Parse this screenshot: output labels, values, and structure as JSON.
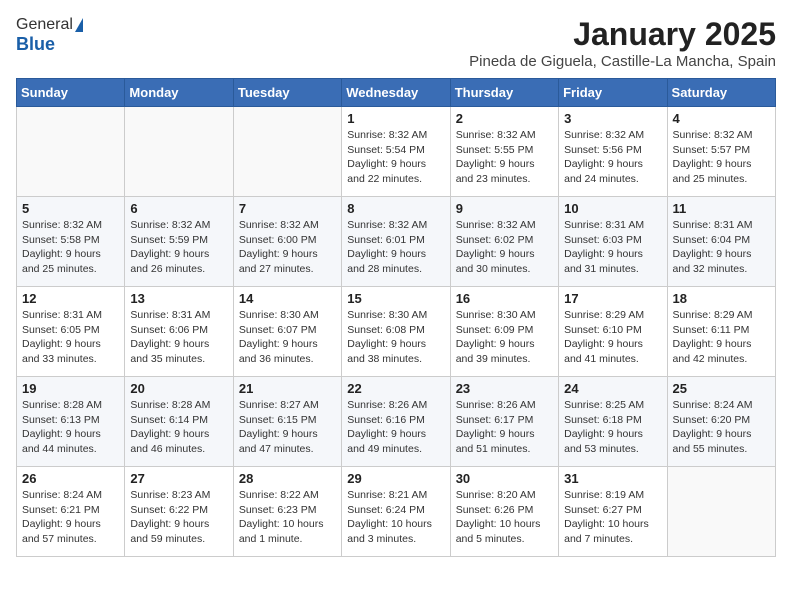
{
  "header": {
    "logo_general": "General",
    "logo_blue": "Blue",
    "month_title": "January 2025",
    "location": "Pineda de Giguela, Castille-La Mancha, Spain"
  },
  "days_of_week": [
    "Sunday",
    "Monday",
    "Tuesday",
    "Wednesday",
    "Thursday",
    "Friday",
    "Saturday"
  ],
  "weeks": [
    [
      {
        "day": "",
        "info": ""
      },
      {
        "day": "",
        "info": ""
      },
      {
        "day": "",
        "info": ""
      },
      {
        "day": "1",
        "info": "Sunrise: 8:32 AM\nSunset: 5:54 PM\nDaylight: 9 hours\nand 22 minutes."
      },
      {
        "day": "2",
        "info": "Sunrise: 8:32 AM\nSunset: 5:55 PM\nDaylight: 9 hours\nand 23 minutes."
      },
      {
        "day": "3",
        "info": "Sunrise: 8:32 AM\nSunset: 5:56 PM\nDaylight: 9 hours\nand 24 minutes."
      },
      {
        "day": "4",
        "info": "Sunrise: 8:32 AM\nSunset: 5:57 PM\nDaylight: 9 hours\nand 25 minutes."
      }
    ],
    [
      {
        "day": "5",
        "info": "Sunrise: 8:32 AM\nSunset: 5:58 PM\nDaylight: 9 hours\nand 25 minutes."
      },
      {
        "day": "6",
        "info": "Sunrise: 8:32 AM\nSunset: 5:59 PM\nDaylight: 9 hours\nand 26 minutes."
      },
      {
        "day": "7",
        "info": "Sunrise: 8:32 AM\nSunset: 6:00 PM\nDaylight: 9 hours\nand 27 minutes."
      },
      {
        "day": "8",
        "info": "Sunrise: 8:32 AM\nSunset: 6:01 PM\nDaylight: 9 hours\nand 28 minutes."
      },
      {
        "day": "9",
        "info": "Sunrise: 8:32 AM\nSunset: 6:02 PM\nDaylight: 9 hours\nand 30 minutes."
      },
      {
        "day": "10",
        "info": "Sunrise: 8:31 AM\nSunset: 6:03 PM\nDaylight: 9 hours\nand 31 minutes."
      },
      {
        "day": "11",
        "info": "Sunrise: 8:31 AM\nSunset: 6:04 PM\nDaylight: 9 hours\nand 32 minutes."
      }
    ],
    [
      {
        "day": "12",
        "info": "Sunrise: 8:31 AM\nSunset: 6:05 PM\nDaylight: 9 hours\nand 33 minutes."
      },
      {
        "day": "13",
        "info": "Sunrise: 8:31 AM\nSunset: 6:06 PM\nDaylight: 9 hours\nand 35 minutes."
      },
      {
        "day": "14",
        "info": "Sunrise: 8:30 AM\nSunset: 6:07 PM\nDaylight: 9 hours\nand 36 minutes."
      },
      {
        "day": "15",
        "info": "Sunrise: 8:30 AM\nSunset: 6:08 PM\nDaylight: 9 hours\nand 38 minutes."
      },
      {
        "day": "16",
        "info": "Sunrise: 8:30 AM\nSunset: 6:09 PM\nDaylight: 9 hours\nand 39 minutes."
      },
      {
        "day": "17",
        "info": "Sunrise: 8:29 AM\nSunset: 6:10 PM\nDaylight: 9 hours\nand 41 minutes."
      },
      {
        "day": "18",
        "info": "Sunrise: 8:29 AM\nSunset: 6:11 PM\nDaylight: 9 hours\nand 42 minutes."
      }
    ],
    [
      {
        "day": "19",
        "info": "Sunrise: 8:28 AM\nSunset: 6:13 PM\nDaylight: 9 hours\nand 44 minutes."
      },
      {
        "day": "20",
        "info": "Sunrise: 8:28 AM\nSunset: 6:14 PM\nDaylight: 9 hours\nand 46 minutes."
      },
      {
        "day": "21",
        "info": "Sunrise: 8:27 AM\nSunset: 6:15 PM\nDaylight: 9 hours\nand 47 minutes."
      },
      {
        "day": "22",
        "info": "Sunrise: 8:26 AM\nSunset: 6:16 PM\nDaylight: 9 hours\nand 49 minutes."
      },
      {
        "day": "23",
        "info": "Sunrise: 8:26 AM\nSunset: 6:17 PM\nDaylight: 9 hours\nand 51 minutes."
      },
      {
        "day": "24",
        "info": "Sunrise: 8:25 AM\nSunset: 6:18 PM\nDaylight: 9 hours\nand 53 minutes."
      },
      {
        "day": "25",
        "info": "Sunrise: 8:24 AM\nSunset: 6:20 PM\nDaylight: 9 hours\nand 55 minutes."
      }
    ],
    [
      {
        "day": "26",
        "info": "Sunrise: 8:24 AM\nSunset: 6:21 PM\nDaylight: 9 hours\nand 57 minutes."
      },
      {
        "day": "27",
        "info": "Sunrise: 8:23 AM\nSunset: 6:22 PM\nDaylight: 9 hours\nand 59 minutes."
      },
      {
        "day": "28",
        "info": "Sunrise: 8:22 AM\nSunset: 6:23 PM\nDaylight: 10 hours\nand 1 minute."
      },
      {
        "day": "29",
        "info": "Sunrise: 8:21 AM\nSunset: 6:24 PM\nDaylight: 10 hours\nand 3 minutes."
      },
      {
        "day": "30",
        "info": "Sunrise: 8:20 AM\nSunset: 6:26 PM\nDaylight: 10 hours\nand 5 minutes."
      },
      {
        "day": "31",
        "info": "Sunrise: 8:19 AM\nSunset: 6:27 PM\nDaylight: 10 hours\nand 7 minutes."
      },
      {
        "day": "",
        "info": ""
      }
    ]
  ]
}
